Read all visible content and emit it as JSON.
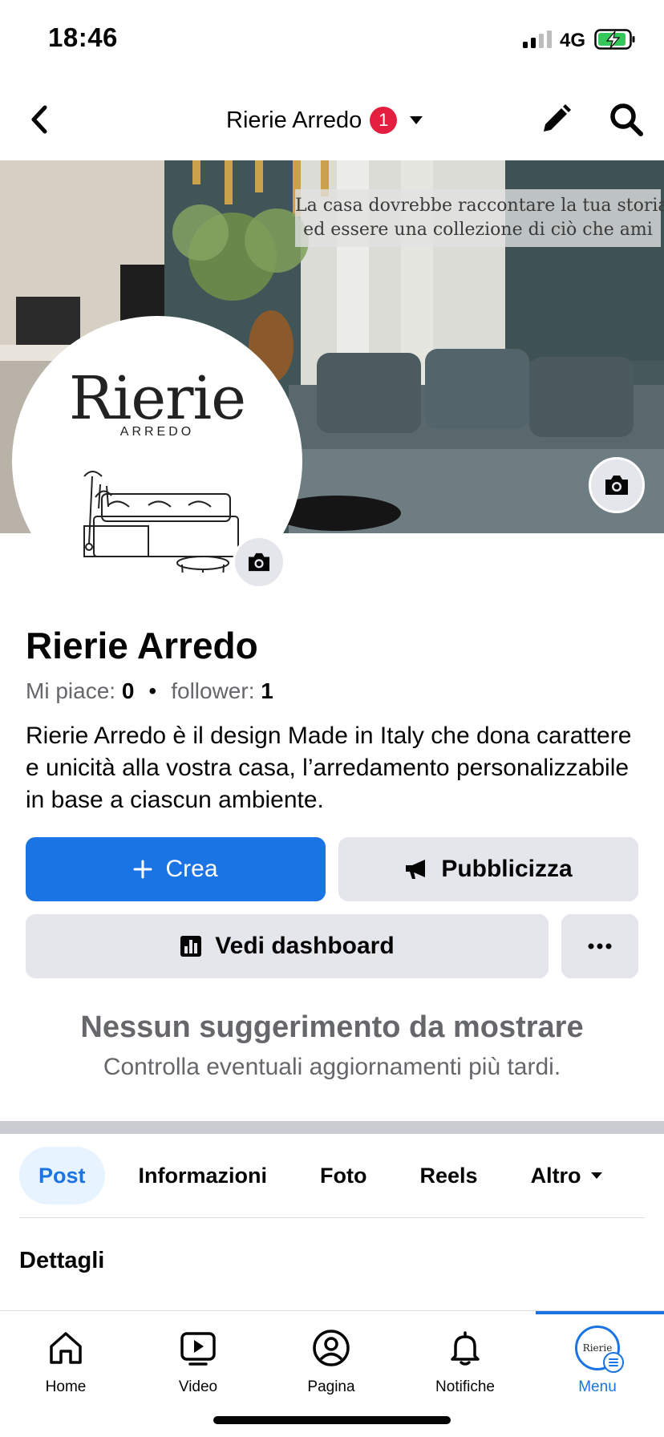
{
  "status_bar": {
    "time": "18:46",
    "network": "4G"
  },
  "header": {
    "page_switcher_label": "Rierie Arredo",
    "notification_count": "1"
  },
  "cover": {
    "quote_line1": "La casa dovrebbe raccontare la tua storia",
    "quote_line2": "ed essere una collezione di ciò che ami"
  },
  "avatar": {
    "logo_title": "Rierie",
    "logo_subtitle": "ARREDO"
  },
  "page": {
    "name": "Rierie Arredo",
    "likes_label": "Mi piace",
    "likes_count": "0",
    "followers_label": "follower",
    "followers_count": "1",
    "bio": "Rierie Arredo è il design Made in Italy che dona carattere e unicità alla vostra casa, l’arredamento personalizzabile in base a ciascun ambiente."
  },
  "actions": {
    "create_label": "Crea",
    "promote_label": "Pubblicizza",
    "dashboard_label": "Vedi dashboard"
  },
  "suggestions": {
    "empty_title": "Nessun suggerimento da mostrare",
    "empty_subtitle": "Controlla eventuali aggiornamenti più tardi."
  },
  "tabs": [
    {
      "label": "Post",
      "active": true
    },
    {
      "label": "Informazioni"
    },
    {
      "label": "Foto"
    },
    {
      "label": "Reels"
    },
    {
      "label": "Altro"
    }
  ],
  "section": {
    "title": "Dettagli"
  },
  "bottom_nav": [
    {
      "label": "Home",
      "icon": "home-icon"
    },
    {
      "label": "Video",
      "icon": "video-icon"
    },
    {
      "label": "Pagina",
      "icon": "profile-icon"
    },
    {
      "label": "Notifiche",
      "icon": "bell-icon"
    },
    {
      "label": "Menu",
      "icon": "menu-avatar-icon",
      "active": true
    }
  ],
  "colors": {
    "accent": "#1b74e4",
    "badge": "#e41e3f",
    "button_grey": "#e4e6eb",
    "muted_text": "#65676b"
  }
}
